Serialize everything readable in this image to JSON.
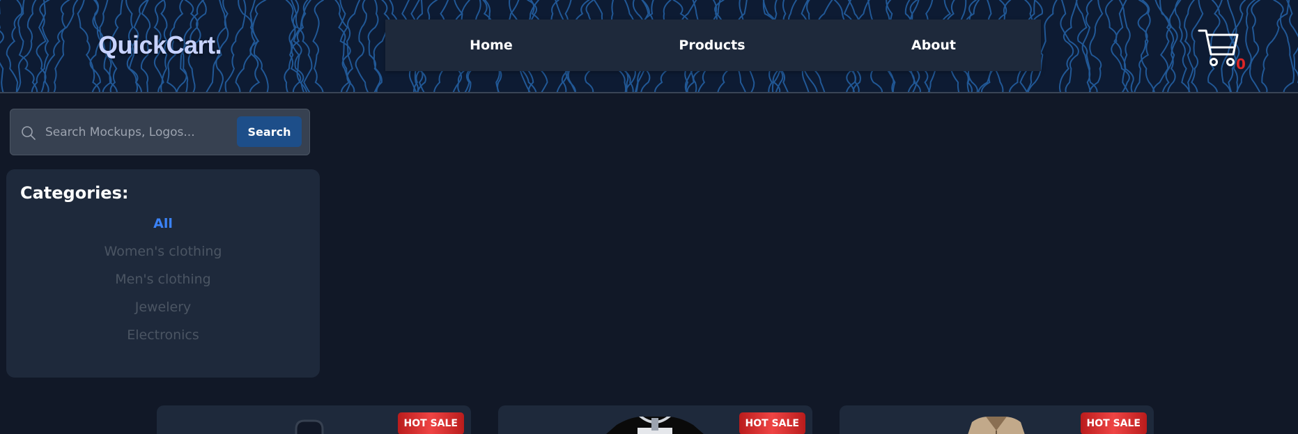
{
  "header": {
    "logo": "QuickCart.",
    "nav": [
      "Home",
      "Products",
      "About"
    ],
    "cart_count": "0"
  },
  "search": {
    "placeholder": "Search Mockups, Logos...",
    "button_label": "Search"
  },
  "categories": {
    "title": "Categories:",
    "items": [
      "All",
      "Women's clothing",
      "Men's clothing",
      "Jewelery",
      "Electronics"
    ],
    "active": "All"
  },
  "products": [
    {
      "badge": "HOT SALE",
      "image": "backpack"
    },
    {
      "badge": "HOT SALE",
      "image": "t-shirt"
    },
    {
      "badge": "HOT SALE",
      "image": "jacket"
    }
  ],
  "colors": {
    "background": "#111827",
    "panel": "#1e293b",
    "accent": "#3b82f6",
    "badge": "#dc2626",
    "button": "#1d4e89"
  }
}
